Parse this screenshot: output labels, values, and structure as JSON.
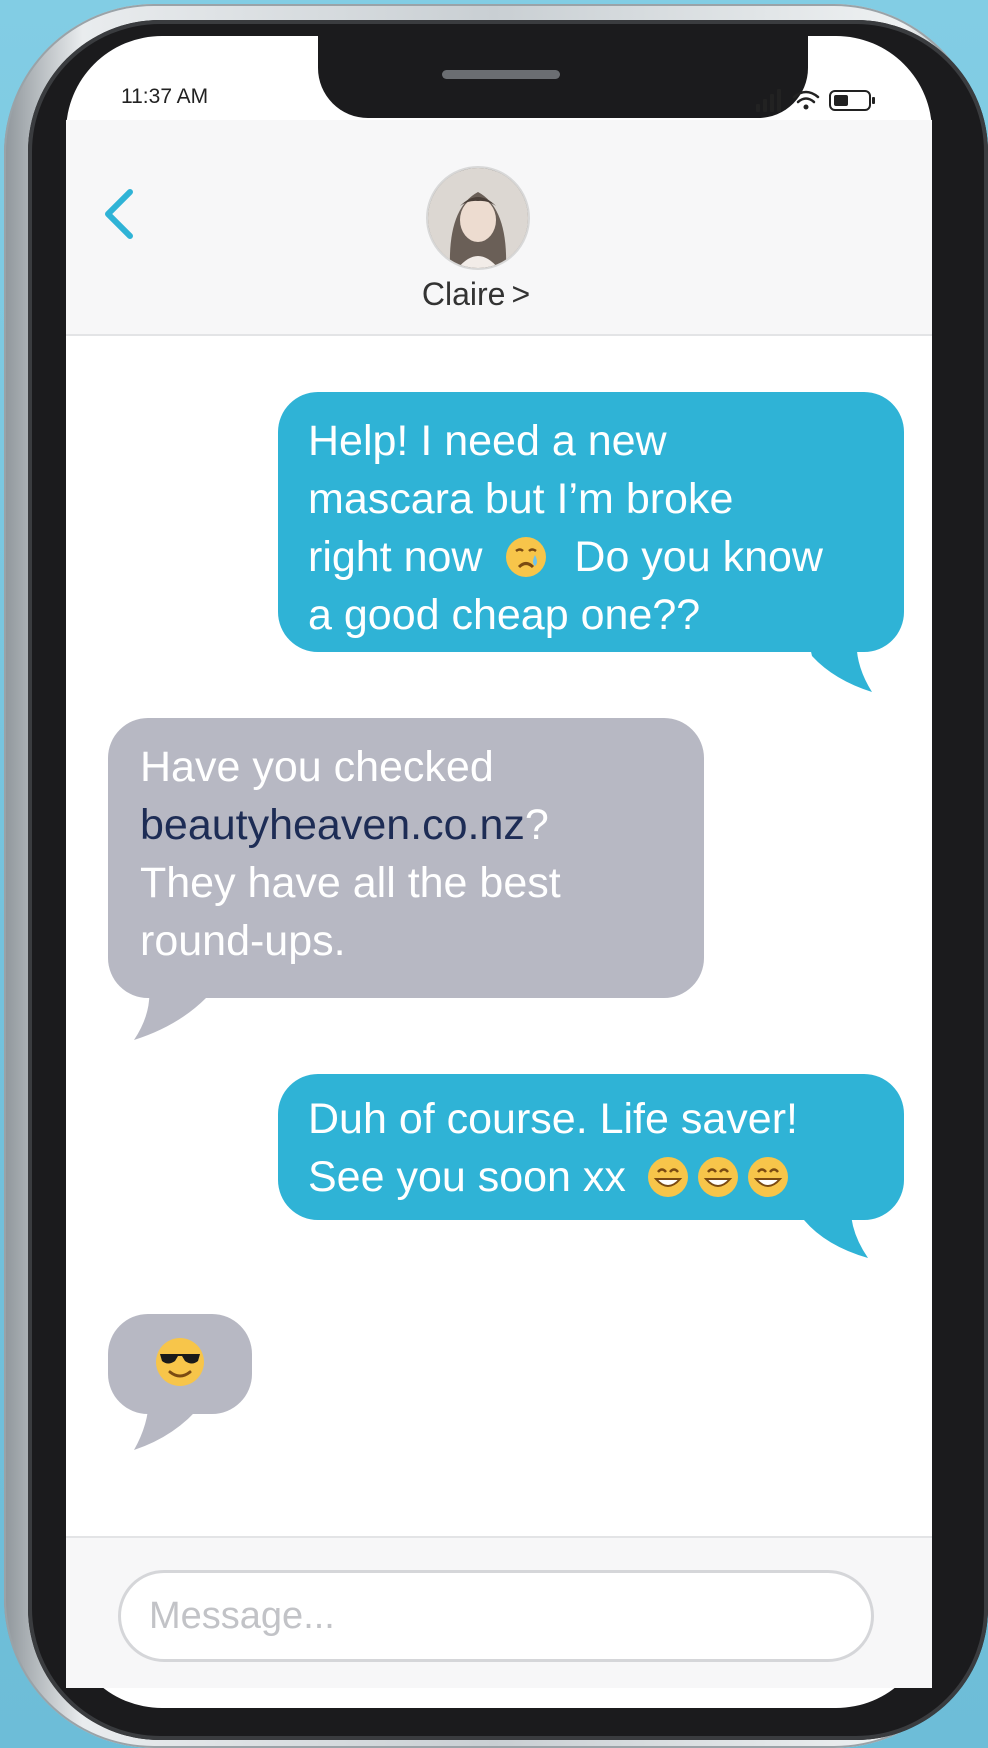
{
  "status_bar": {
    "time": "11:37 AM",
    "icons": [
      "signal-icon",
      "wifi-icon",
      "battery-icon"
    ]
  },
  "header": {
    "contact_name": "Claire",
    "chevron": ">",
    "back_icon": "chevron-left-icon"
  },
  "messages": [
    {
      "direction": "outgoing",
      "lines": [
        "Help! I need a new",
        "mascara but I’m broke",
        "right now",
        "Do you know",
        "a good cheap one??"
      ],
      "emoji": "crying-face-emoji"
    },
    {
      "direction": "incoming",
      "lines": [
        "Have you checked",
        "beautyheaven.co.nz",
        "?",
        "They have all the best",
        "round-ups."
      ],
      "link": "beautyheaven.co.nz"
    },
    {
      "direction": "outgoing",
      "lines": [
        "Duh of course. Life saver!",
        "See you soon xx"
      ],
      "emoji": "grinning-face-emoji x3"
    },
    {
      "direction": "incoming",
      "emoji": "sunglasses-face-emoji"
    }
  ],
  "composer": {
    "placeholder": "Message..."
  },
  "colors": {
    "outgoing_bubble": "#2fb3d6",
    "incoming_bubble": "#b7b8c3",
    "link": "#1d2c55",
    "accent": "#2fb3d6",
    "background": "#79c7e0"
  }
}
